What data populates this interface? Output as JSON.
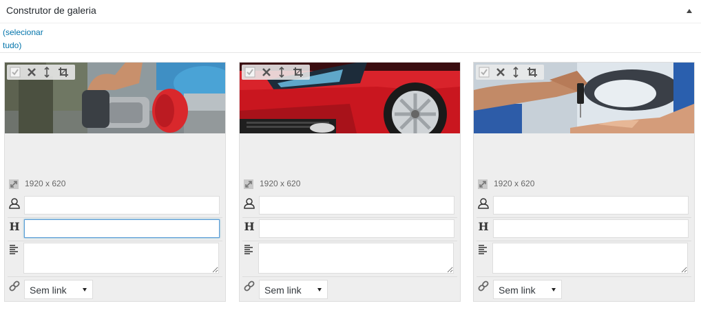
{
  "header": {
    "title": "Construtor de galeria",
    "collapse_icon": "triangle-up-icon"
  },
  "select_all": {
    "line1": "(selecionar",
    "line2": "tudo)"
  },
  "colors": {
    "link": "#0073aa",
    "card_bg": "#eeeeee",
    "focus_border": "#5b9dd9"
  },
  "toolbar_icons": [
    "checkbox-icon",
    "close-icon",
    "sort-arrows-icon",
    "crop-icon"
  ],
  "items": [
    {
      "image_subject": "car polishing machine",
      "dimensions": "1920 x 620",
      "author_value": "",
      "title_value": "",
      "description_value": "",
      "link_select": "Sem link"
    },
    {
      "image_subject": "red car front",
      "dimensions": "1920 x 620",
      "author_value": "",
      "title_value": "",
      "description_value": "",
      "link_select": "Sem link"
    },
    {
      "image_subject": "car key handover",
      "dimensions": "1920 x 620",
      "author_value": "",
      "title_value": "",
      "description_value": "",
      "link_select": "Sem link"
    }
  ]
}
